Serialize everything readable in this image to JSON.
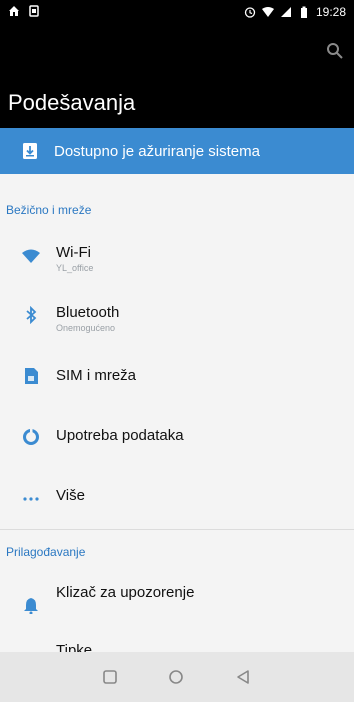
{
  "status": {
    "time": "19:28",
    "icons": [
      "home-notification-icon",
      "app-notification-icon",
      "alarm-icon",
      "wifi-signal-icon",
      "cell-signal-icon",
      "battery-icon"
    ]
  },
  "header": {
    "title": "Podešavanja"
  },
  "update_banner": {
    "text": "Dostupno je ažuriranje sistema"
  },
  "sections": [
    {
      "title": "Bežično i mreže",
      "items": [
        {
          "label": "Wi-Fi",
          "sub": "YL_office",
          "icon": "wifi-icon"
        },
        {
          "label": "Bluetooth",
          "sub": "Onemogućeno",
          "icon": "bluetooth-icon"
        },
        {
          "label": "SIM i mreža",
          "sub": "",
          "icon": "sim-card-icon"
        },
        {
          "label": "Upotreba podataka",
          "sub": "",
          "icon": "data-usage-icon"
        },
        {
          "label": "Više",
          "sub": "",
          "icon": "more-icon"
        }
      ]
    },
    {
      "title": "Prilagođavanje",
      "items": [
        {
          "label": "Klizač za upozorenje",
          "sub": "",
          "icon": "alert-slider-icon"
        },
        {
          "label": "Tipke",
          "sub": "",
          "icon": "buttons-icon"
        }
      ]
    }
  ],
  "colors": {
    "accent": "#3b8bd1",
    "section_header": "#2b78c2",
    "header_bg": "#000000",
    "page_bg": "#f4f4f4"
  }
}
